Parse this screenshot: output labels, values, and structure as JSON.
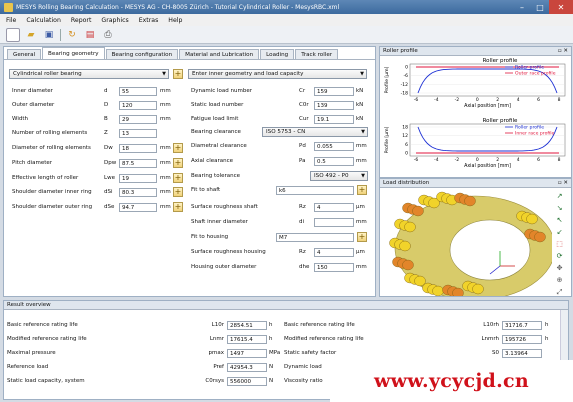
{
  "window": {
    "title": "MESYS Rolling Bearing Calculation - MESYS AG - CH-8005 Zürich - Tutorial Cylindrical Roller - MesysRBC.xml",
    "min": "–",
    "max": "□",
    "close": "✕"
  },
  "menu": [
    "File",
    "Calculation",
    "Report",
    "Graphics",
    "Extras",
    "Help"
  ],
  "tabs": [
    "General",
    "Bearing geometry",
    "Bearing configuration",
    "Material and Lubrication",
    "Loading",
    "Track roller"
  ],
  "left": {
    "type_select": "Cylindrical roller bearing",
    "rows": [
      {
        "label": "Inner diameter",
        "sym": "d",
        "value": "55",
        "unit": "mm"
      },
      {
        "label": "Outer diameter",
        "sym": "D",
        "value": "120",
        "unit": "mm"
      },
      {
        "label": "Width",
        "sym": "B",
        "value": "29",
        "unit": "mm"
      },
      {
        "label": "Number of rolling elements",
        "sym": "Z",
        "value": "13",
        "unit": ""
      },
      {
        "label": "Diameter of rolling elements",
        "sym": "Dw",
        "value": "18",
        "unit": "mm"
      },
      {
        "label": "Pitch diameter",
        "sym": "Dpw",
        "value": "87.5",
        "unit": "mm"
      },
      {
        "label": "Effective length of roller",
        "sym": "Lwe",
        "value": "19",
        "unit": "mm"
      },
      {
        "label": "Shoulder diameter inner ring",
        "sym": "dSi",
        "value": "80.3",
        "unit": "mm"
      },
      {
        "label": "Shoulder diameter outer ring",
        "sym": "dSe",
        "value": "94.7",
        "unit": "mm"
      }
    ]
  },
  "right": {
    "input_select": "Enter inner geometry and load capacity",
    "rows1": [
      {
        "label": "Dynamic load number",
        "sym": "Cr",
        "value": "159",
        "unit": "kN"
      },
      {
        "label": "Static load number",
        "sym": "C0r",
        "value": "139",
        "unit": "kN"
      },
      {
        "label": "Fatigue load limit",
        "sym": "Cur",
        "value": "19.1",
        "unit": "kN"
      }
    ],
    "clearance_label": "Bearing clearance",
    "clearance_value": "ISO 5753 - CN",
    "rows2": [
      {
        "label": "Diametral clearance",
        "sym": "Pd",
        "value": "0.055",
        "unit": "mm"
      },
      {
        "label": "Axial clearance",
        "sym": "Pa",
        "value": "0.5",
        "unit": "mm"
      }
    ],
    "tolerance_label": "Bearing tolerance",
    "tolerance_value": "ISO 492 - P0",
    "fit_shaft_label": "Fit to shaft",
    "fit_shaft_value": "k6",
    "rough_shaft_label": "Surface roughness shaft",
    "rough_shaft_sym": "Rz",
    "rough_shaft_value": "4",
    "rough_shaft_unit": "µm",
    "shaft_inner_label": "Shaft inner diameter",
    "shaft_inner_sym": "di",
    "shaft_inner_unit": "mm",
    "fit_housing_label": "Fit to housing",
    "fit_housing_value": "M7",
    "rough_housing_label": "Surface roughness housing",
    "rough_housing_sym": "Rz",
    "rough_housing_value": "4",
    "rough_housing_unit": "µm",
    "housing_outer_label": "Housing outer diameter",
    "housing_outer_sym": "dhe",
    "housing_outer_value": "150",
    "housing_outer_unit": "mm"
  },
  "roller_profile": {
    "panel_title": "Roller profile",
    "top": {
      "title": "Roller profile",
      "ylabel": "Profile [µm]",
      "xlabel": "Axial position [mm]",
      "legend": [
        "Roller profile",
        "Outer race profile"
      ],
      "yticks": [
        "0",
        "-6",
        "-12",
        "-18"
      ],
      "xticks": [
        "-6",
        "-4",
        "-2",
        "0",
        "2",
        "4",
        "6",
        "8"
      ]
    },
    "bottom": {
      "title": "Roller profile",
      "ylabel": "Profile [µm]",
      "xlabel": "Axial position [mm]",
      "legend": [
        "Roller profile",
        "Inner race profile"
      ],
      "yticks": [
        "18",
        "12",
        "6",
        "0"
      ],
      "xticks": [
        "-6",
        "-4",
        "-2",
        "0",
        "2",
        "4",
        "6",
        "8"
      ]
    }
  },
  "load_distribution": {
    "panel_title": "Load distribution"
  },
  "result": {
    "title": "Result overview",
    "left": [
      {
        "label": "Basic reference rating life",
        "sym": "L10r",
        "value": "2854.51",
        "unit": "h"
      },
      {
        "label": "Modified reference rating life",
        "sym": "Lnmr",
        "value": "17615.4",
        "unit": "h"
      },
      {
        "label": "Maximal pressure",
        "sym": "pmax",
        "value": "1497",
        "unit": "MPa"
      },
      {
        "label": "Reference load",
        "sym": "Pref",
        "value": "42954.3",
        "unit": "N"
      },
      {
        "label": "Static load capacity, system",
        "sym": "C0rsys",
        "value": "556000",
        "unit": "N"
      }
    ],
    "right": [
      {
        "label": "Basic reference rating life",
        "sym": "L10rh",
        "value": "31716.7",
        "unit": "h"
      },
      {
        "label": "Modified reference rating life",
        "sym": "Lnmrh",
        "value": "195726",
        "unit": "h"
      },
      {
        "label": "Static safety factor",
        "sym": "S0",
        "value": "3.13964",
        "unit": ""
      },
      {
        "label": "Dynamic load",
        "sym": "",
        "value": "",
        "unit": ""
      },
      {
        "label": "Viscosity ratio",
        "sym": "",
        "value": "",
        "unit": ""
      }
    ]
  },
  "watermark": "www.ycycjd.cn",
  "colors": {
    "outer_race": "#e0163c",
    "inner_race": "#e0163c",
    "roller": "#1c2fd4",
    "roller_yellow": "#f1d32a",
    "roller_orange": "#e2852a"
  }
}
